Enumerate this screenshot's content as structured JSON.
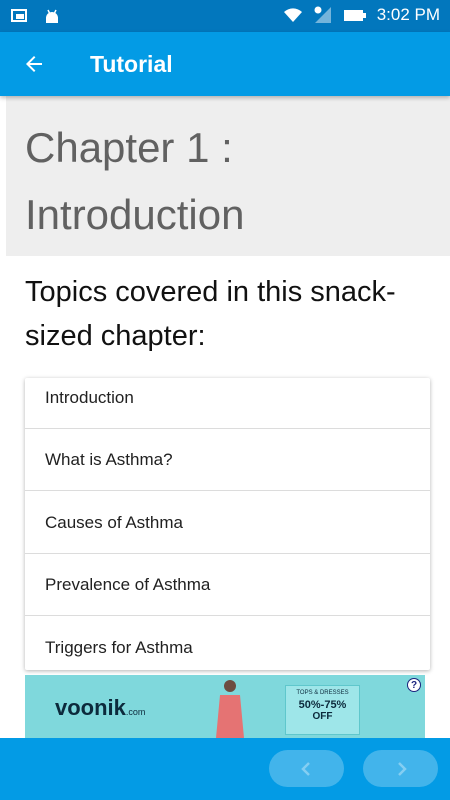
{
  "status_bar": {
    "time": "3:02 PM"
  },
  "app_bar": {
    "title": "Tutorial",
    "back_icon": "arrow-back-icon"
  },
  "chapter": {
    "title": "Chapter 1 : Introduction",
    "topics_heading": "Topics covered in this snack-sized chapter:"
  },
  "topics": [
    {
      "label": "Introduction"
    },
    {
      "label": "What is Asthma?"
    },
    {
      "label": "Causes of Asthma"
    },
    {
      "label": "Prevalence of Asthma"
    },
    {
      "label": "Triggers for Asthma"
    }
  ],
  "ad": {
    "brand": "voonik",
    "brand_suffix": ".com",
    "offer_line1": "TOPS & DRESSES",
    "offer_line2": "50%-75%",
    "offer_line3": "OFF",
    "info_icon": "question-icon"
  },
  "nav": {
    "prev_icon": "chevron-left-icon",
    "next_icon": "chevron-right-icon"
  },
  "colors": {
    "status_bar": "#0277bd",
    "app_bar": "#039be5",
    "chapter_bg": "#eeeeee",
    "ad_bg": "#7fd8dc"
  }
}
